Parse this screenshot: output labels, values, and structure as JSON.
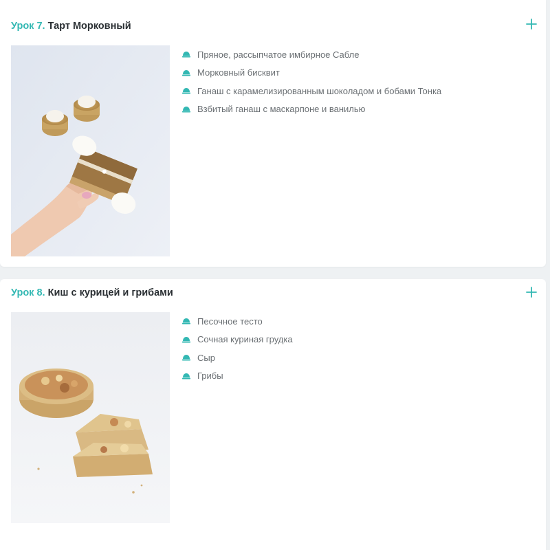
{
  "accent_color": "#33b8b3",
  "lessons": [
    {
      "num_label": "Урок 7.",
      "title": "Тарт Морковный",
      "items": [
        "Пряное, рассыпчатое имбирное Сабле",
        "Морковный бисквит",
        "Ганаш с карамелизированным шоколадом и бобами Тонка",
        "Взбитый ганаш с маскарпоне и ванилью"
      ],
      "icons": {
        "expand": "plus-icon",
        "bullet": "dessert-icon"
      }
    },
    {
      "num_label": "Урок 8.",
      "title": "Киш с курицей и грибами",
      "items": [
        "Песочное тесто",
        "Сочная куриная грудка",
        "Сыр",
        "Грибы"
      ],
      "icons": {
        "expand": "plus-icon",
        "bullet": "dessert-icon"
      }
    }
  ]
}
